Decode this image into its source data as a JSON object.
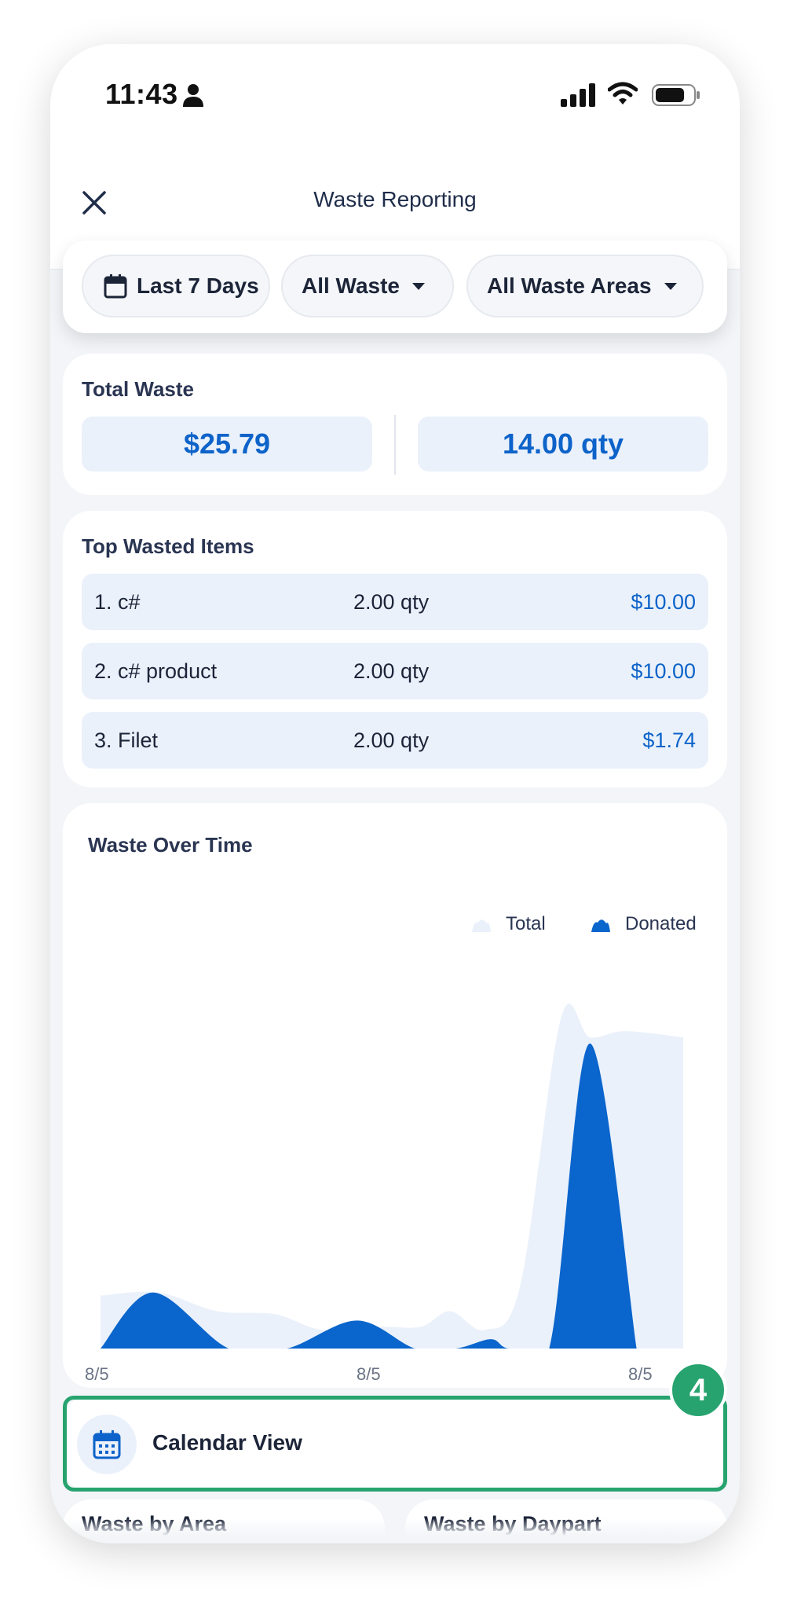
{
  "status_bar": {
    "time": "11:43"
  },
  "header": {
    "title": "Waste Reporting"
  },
  "filters": {
    "date_range": "Last 7 Days",
    "waste_type": "All Waste",
    "waste_area": "All Waste Areas"
  },
  "total_waste": {
    "title": "Total Waste",
    "cost": "$25.79",
    "quantity": "14.00 qty"
  },
  "top_items": {
    "title": "Top Wasted Items",
    "items": [
      {
        "name": "1. c#",
        "qty": "2.00 qty",
        "cost": "$10.00"
      },
      {
        "name": "2. c# product",
        "qty": "2.00 qty",
        "cost": "$10.00"
      },
      {
        "name": "3. Filet",
        "qty": "2.00 qty",
        "cost": "$1.74"
      }
    ]
  },
  "chart_data": {
    "type": "area",
    "title": "Waste Over Time",
    "x_tick_labels": [
      "8/5",
      "8/5",
      "8/5"
    ],
    "y_axis_shown": false,
    "grid": false,
    "legend_position": "top-right",
    "series": [
      {
        "name": "Total",
        "color": "#eaf1fb",
        "x": [
          0,
          0.1,
          0.2,
          0.3,
          0.38,
          0.48,
          0.55,
          0.6,
          0.66,
          0.72,
          0.79,
          0.84,
          0.9,
          1.0
        ],
        "values": [
          0.17,
          0.18,
          0.12,
          0.11,
          0.06,
          0.07,
          0.07,
          0.12,
          0.06,
          0.2,
          1.06,
          1.0,
          1.02,
          1.0
        ]
      },
      {
        "name": "Donated",
        "color": "#0a65cc",
        "x": [
          0,
          0.09,
          0.22,
          0.32,
          0.44,
          0.54,
          0.61,
          0.67,
          0.7,
          0.77,
          0.84,
          0.92
        ],
        "values": [
          0,
          0.18,
          0,
          0,
          0.09,
          0,
          0,
          0.03,
          0,
          0,
          0.98,
          0
        ]
      }
    ]
  },
  "calendar": {
    "label": "Calendar View",
    "step_number": "4"
  },
  "bottom_cards": {
    "area_title": "Waste by Area",
    "dayport_title": "Waste by Daypart"
  },
  "colors": {
    "accent": "#0d63c9",
    "highlight": "#27a36f",
    "light_blue": "#eaf1fb"
  }
}
